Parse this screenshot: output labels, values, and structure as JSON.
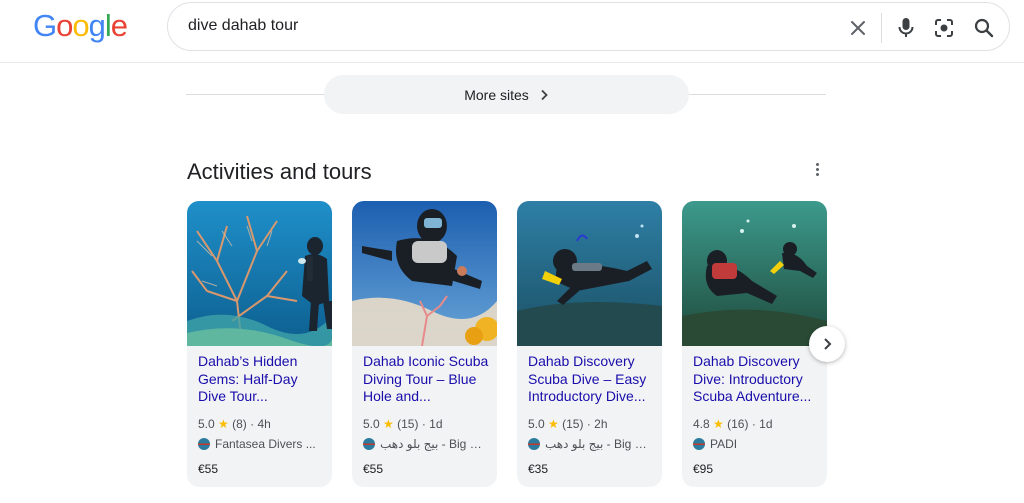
{
  "logo": {
    "letters": [
      "G",
      "o",
      "o",
      "g",
      "l",
      "e"
    ],
    "colors": [
      "#4285F4",
      "#EA4335",
      "#FBBC05",
      "#4285F4",
      "#34A853",
      "#EA4335"
    ]
  },
  "search": {
    "value": "dive dahab tour",
    "icons": [
      "close-icon",
      "microphone-icon",
      "camera-lens-icon",
      "search-icon"
    ]
  },
  "more_sites": {
    "label": "More sites"
  },
  "activities": {
    "title": "Activities and tours",
    "cards": [
      {
        "title": "Dahab’s Hidden Gems: Half-Day Dive Tour...",
        "rating": "5.0",
        "reviews": "(8)",
        "age": "4h",
        "source": "Fantasea Divers ...",
        "price": "€55"
      },
      {
        "title": "Dahab Iconic Scuba Diving Tour – Blue Hole and...",
        "rating": "5.0",
        "reviews": "(15)",
        "age": "1d",
        "source": "بيج بلو دهب - Big Bl...",
        "price": "€55"
      },
      {
        "title": "Dahab Discovery Scuba Dive – Easy Introductory Dive...",
        "rating": "5.0",
        "reviews": "(15)",
        "age": "2h",
        "source": "بيج بلو دهب - Big Bl...",
        "price": "€35"
      },
      {
        "title": "Dahab Discovery Dive: Introductory Scuba Adventure...",
        "rating": "4.8",
        "reviews": "(16)",
        "age": "1d",
        "source": "PADI",
        "price": "€95"
      }
    ]
  },
  "colors": {
    "link": "#1a0dab",
    "star": "#fbbc04",
    "card_bg": "#f1f3f4"
  }
}
